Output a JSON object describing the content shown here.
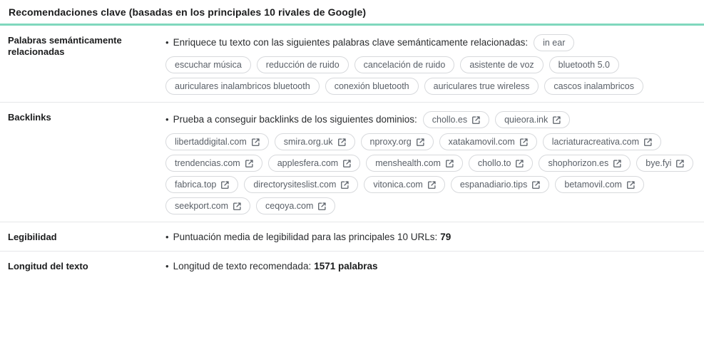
{
  "header": {
    "title": "Recomendaciones clave (basadas en los principales 10 rivales de Google)",
    "accent_color": "#7fd8bd"
  },
  "sections": {
    "semantic": {
      "label": "Palabras semánticamente relacionadas",
      "bullet": "Enriquece tu texto con las siguientes palabras clave semánticamente relacionadas:",
      "chips": [
        "in ear",
        "escuchar música",
        "reducción de ruido",
        "cancelación de ruido",
        "asistente de voz",
        "bluetooth 5.0",
        "auriculares inalambricos bluetooth",
        "conexión bluetooth",
        "auriculares true wireless",
        "cascos inalambricos"
      ]
    },
    "backlinks": {
      "label": "Backlinks",
      "bullet": "Prueba a conseguir backlinks de los siguientes dominios:",
      "icon": "external-link-icon",
      "chips": [
        "chollo.es",
        "quieora.ink",
        "libertaddigital.com",
        "smira.org.uk",
        "nproxy.org",
        "xatakamovil.com",
        "lacriaturacreativa.com",
        "trendencias.com",
        "applesfera.com",
        "menshealth.com",
        "chollo.to",
        "shophorizon.es",
        "bye.fyi",
        "fabrica.top",
        "directorysiteslist.com",
        "vitonica.com",
        "espanadiario.tips",
        "betamovil.com",
        "seekport.com",
        "ceqoya.com"
      ]
    },
    "readability": {
      "label": "Legibilidad",
      "bullet": "Puntuación media de legibilidad para las principales 10 URLs:",
      "value": "79"
    },
    "text_length": {
      "label": "Longitud del texto",
      "bullet": "Longitud de texto recomendada:",
      "value": "1571 palabras"
    }
  }
}
